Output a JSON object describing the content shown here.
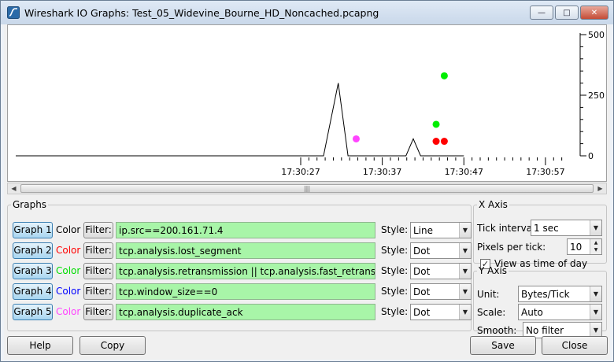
{
  "window": {
    "title": "Wireshark IO Graphs: Test_05_Widevine_Bourne_HD_Noncached.pcapng",
    "min_icon": "minimize-icon",
    "max_icon": "maximize-icon",
    "close_icon": "close-icon"
  },
  "chart_data": {
    "type": "line",
    "x_tick_labels": [
      "17:30:27",
      "17:30:37",
      "17:30:47",
      "17:30:57"
    ],
    "y_tick_labels": [
      "500",
      "250",
      "0"
    ],
    "ylim": [
      0,
      500
    ],
    "series": [
      {
        "color": "#000000",
        "style": "Line",
        "points": [
          [
            17,
            0
          ],
          [
            29,
            0
          ],
          [
            29.8,
            0
          ],
          [
            31.6,
            300
          ],
          [
            32.8,
            0
          ],
          [
            39.9,
            0
          ],
          [
            40.8,
            70
          ],
          [
            41.7,
            0
          ],
          [
            47,
            0
          ]
        ]
      },
      {
        "color": "#ff0000",
        "style": "Dot",
        "points": [
          [
            43.6,
            60
          ],
          [
            44.6,
            60
          ]
        ]
      },
      {
        "color": "#00ee00",
        "style": "Dot",
        "points": [
          [
            43.6,
            130
          ],
          [
            44.6,
            330
          ]
        ]
      },
      {
        "color": "#ff44ff",
        "style": "Dot",
        "points": [
          [
            33.8,
            70
          ]
        ]
      }
    ]
  },
  "graphs_label": "Graphs",
  "graphs": [
    {
      "button": "Graph 1",
      "color_label": "Color",
      "color": "#000000",
      "filter_label": "Filter:",
      "filter": "ip.src==200.161.71.4",
      "style_label": "Style:",
      "style": "Line"
    },
    {
      "button": "Graph 2",
      "color_label": "Color",
      "color": "#ff0000",
      "filter_label": "Filter:",
      "filter": "tcp.analysis.lost_segment",
      "style_label": "Style:",
      "style": "Dot"
    },
    {
      "button": "Graph 3",
      "color_label": "Color",
      "color": "#00dd00",
      "filter_label": "Filter:",
      "filter": "tcp.analysis.retransmission || tcp.analysis.fast_retransmission",
      "style_label": "Style:",
      "style": "Dot"
    },
    {
      "button": "Graph 4",
      "color_label": "Color",
      "color": "#0000ff",
      "filter_label": "Filter:",
      "filter": "tcp.window_size==0",
      "style_label": "Style:",
      "style": "Dot"
    },
    {
      "button": "Graph 5",
      "color_label": "Color",
      "color": "#ff44ff",
      "filter_label": "Filter:",
      "filter": "tcp.analysis.duplicate_ack",
      "style_label": "Style:",
      "style": "Dot"
    }
  ],
  "x_axis": {
    "label": "X Axis",
    "tick_interval_label": "Tick interval:",
    "tick_interval": "1 sec",
    "pixels_per_tick_label": "Pixels per tick:",
    "pixels_per_tick": "10",
    "view_as_time_label": "View as time of day",
    "view_as_time_checked": true
  },
  "y_axis": {
    "label": "Y Axis",
    "unit_label": "Unit:",
    "unit": "Bytes/Tick",
    "scale_label": "Scale:",
    "scale": "Auto",
    "smooth_label": "Smooth:",
    "smooth": "No filter"
  },
  "buttons": {
    "help": "Help",
    "copy": "Copy",
    "save": "Save",
    "close": "Close"
  }
}
